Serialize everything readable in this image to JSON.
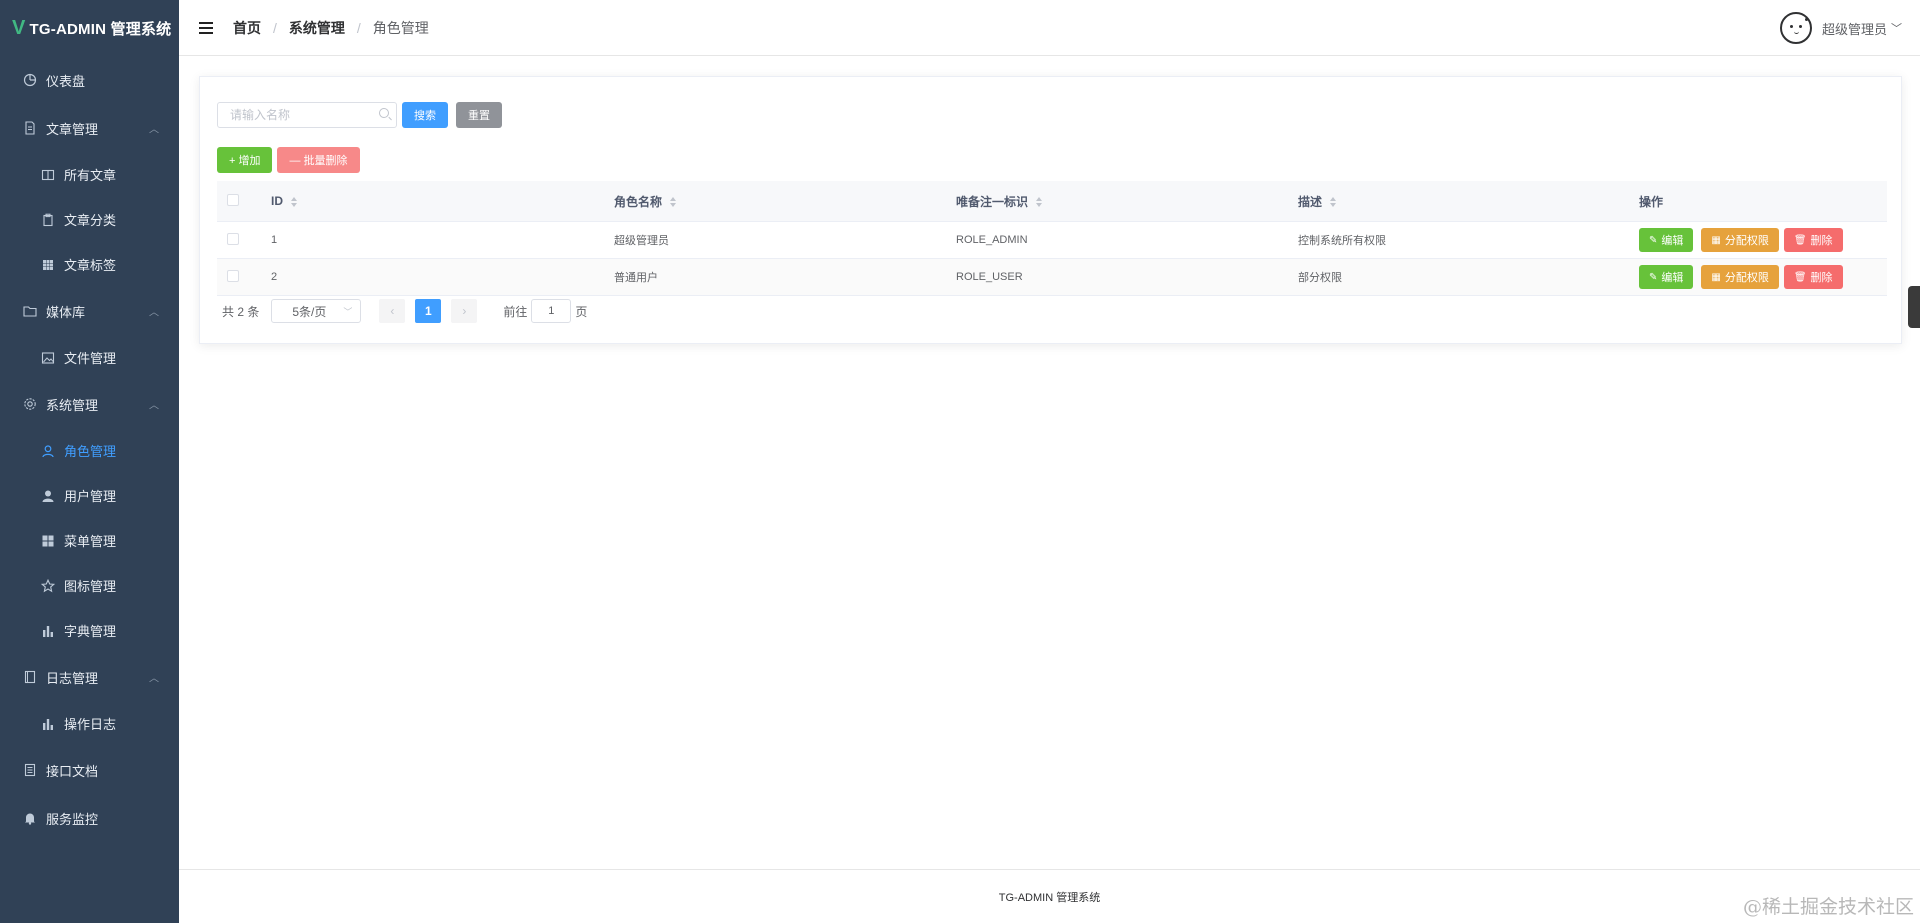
{
  "app": {
    "logo_letter": "V",
    "title": "TG-ADMIN 管理系统"
  },
  "sidebar": {
    "items": [
      {
        "label": "仪表盘",
        "icon": "dashboard-icon",
        "level": 1
      },
      {
        "label": "文章管理",
        "icon": "document-icon",
        "level": 1,
        "expanded": true
      },
      {
        "label": "所有文章",
        "icon": "book-icon",
        "level": 2
      },
      {
        "label": "文章分类",
        "icon": "clipboard-icon",
        "level": 2
      },
      {
        "label": "文章标签",
        "icon": "grid-icon",
        "level": 2
      },
      {
        "label": "媒体库",
        "icon": "folder-icon",
        "level": 1,
        "expanded": true
      },
      {
        "label": "文件管理",
        "icon": "picture-icon",
        "level": 2
      },
      {
        "label": "系统管理",
        "icon": "settings-icon",
        "level": 1,
        "expanded": true
      },
      {
        "label": "角色管理",
        "icon": "user-icon",
        "level": 2,
        "active": true
      },
      {
        "label": "用户管理",
        "icon": "user-solid-icon",
        "level": 2
      },
      {
        "label": "菜单管理",
        "icon": "menu-icon",
        "level": 2
      },
      {
        "label": "图标管理",
        "icon": "star-icon",
        "level": 2
      },
      {
        "label": "字典管理",
        "icon": "bar-chart-icon",
        "level": 2
      },
      {
        "label": "日志管理",
        "icon": "notebook-icon",
        "level": 1,
        "expanded": true
      },
      {
        "label": "操作日志",
        "icon": "bar-chart-icon",
        "level": 2
      },
      {
        "label": "接口文档",
        "icon": "tickets-icon",
        "level": 1
      },
      {
        "label": "服务监控",
        "icon": "bell-icon",
        "level": 1
      }
    ]
  },
  "header": {
    "breadcrumb": [
      "首页",
      "系统管理",
      "角色管理"
    ],
    "user_name": "超级管理员"
  },
  "search": {
    "placeholder": "请输入名称",
    "value": "",
    "search_label": "搜索",
    "reset_label": "重置"
  },
  "actions": {
    "add_label": "+ 增加",
    "batch_delete_label": "— 批量删除"
  },
  "table": {
    "columns": [
      "ID",
      "角色名称",
      "唯备注一标识",
      "描述",
      "操作"
    ],
    "rows": [
      {
        "id": "1",
        "name": "超级管理员",
        "code": "ROLE_ADMIN",
        "desc": "控制系统所有权限"
      },
      {
        "id": "2",
        "name": "普通用户",
        "code": "ROLE_USER",
        "desc": "部分权限"
      }
    ],
    "op_labels": {
      "edit": "编辑",
      "assign": "分配权限",
      "delete": "删除"
    }
  },
  "pagination": {
    "total_text": "共 2 条",
    "page_size": "5条/页",
    "current_page": "1",
    "goto_prefix": "前往",
    "goto_value": "1",
    "goto_suffix": "页"
  },
  "footer": {
    "text": "TG-ADMIN 管理系统"
  },
  "watermark": "@稀土掘金技术社区",
  "colors": {
    "sidebar_bg": "#304156",
    "active": "#409eff",
    "success": "#67c23a",
    "warning": "#e6a23c",
    "danger": "#f56c6c",
    "info": "#909399"
  }
}
